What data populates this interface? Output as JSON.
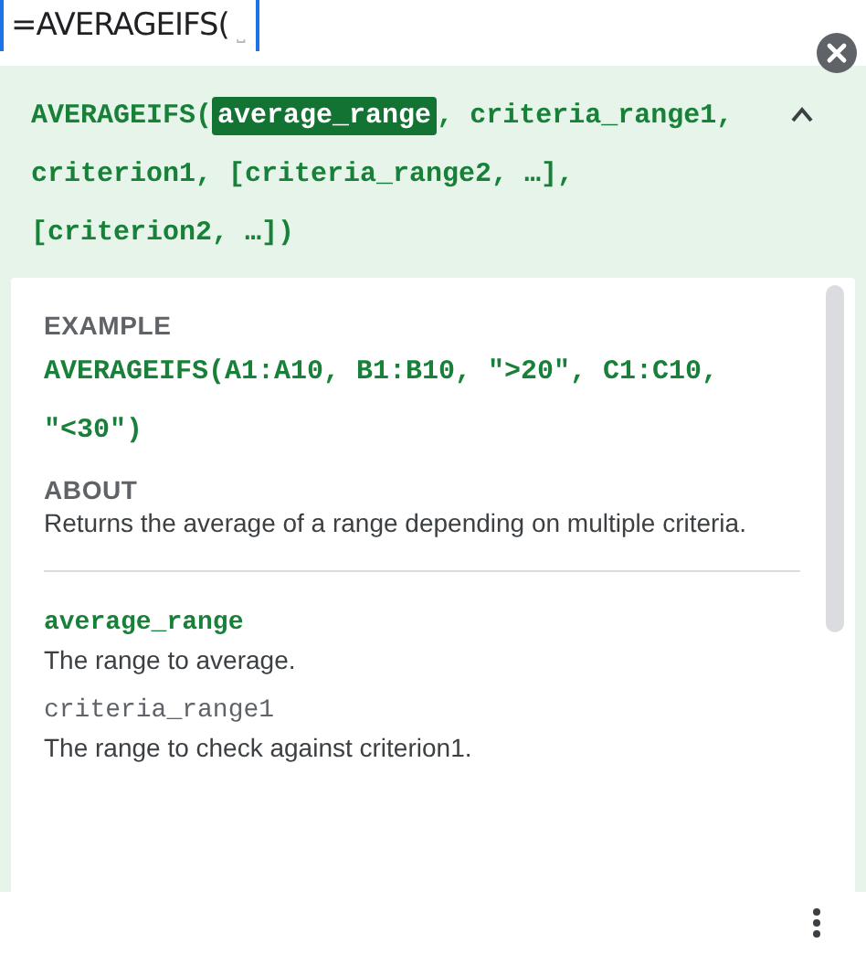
{
  "formula_bar": {
    "value": "=AVERAGEIFS(",
    "placeholder_glyph": "⎵"
  },
  "signature": [
    {
      "text": "AVERAGEIFS(",
      "highlighted": false
    },
    {
      "text": "average_range",
      "highlighted": true
    },
    {
      "text": ", criteria_range1, criterion1, [criteria_range2, …], [criterion2, …])",
      "highlighted": false
    }
  ],
  "expanded": true,
  "example": {
    "heading": "EXAMPLE",
    "code": "AVERAGEIFS(A1:A10, B1:B10, \">20\", C1:C10, \"<30\")"
  },
  "about": {
    "heading": "ABOUT",
    "text": "Returns the average of a range depending on multiple criteria."
  },
  "parameters": [
    {
      "name": "average_range",
      "description": "The range to average.",
      "selected": true
    },
    {
      "name": "criteria_range1",
      "description": "The range to check against criterion1.",
      "selected": false
    }
  ]
}
